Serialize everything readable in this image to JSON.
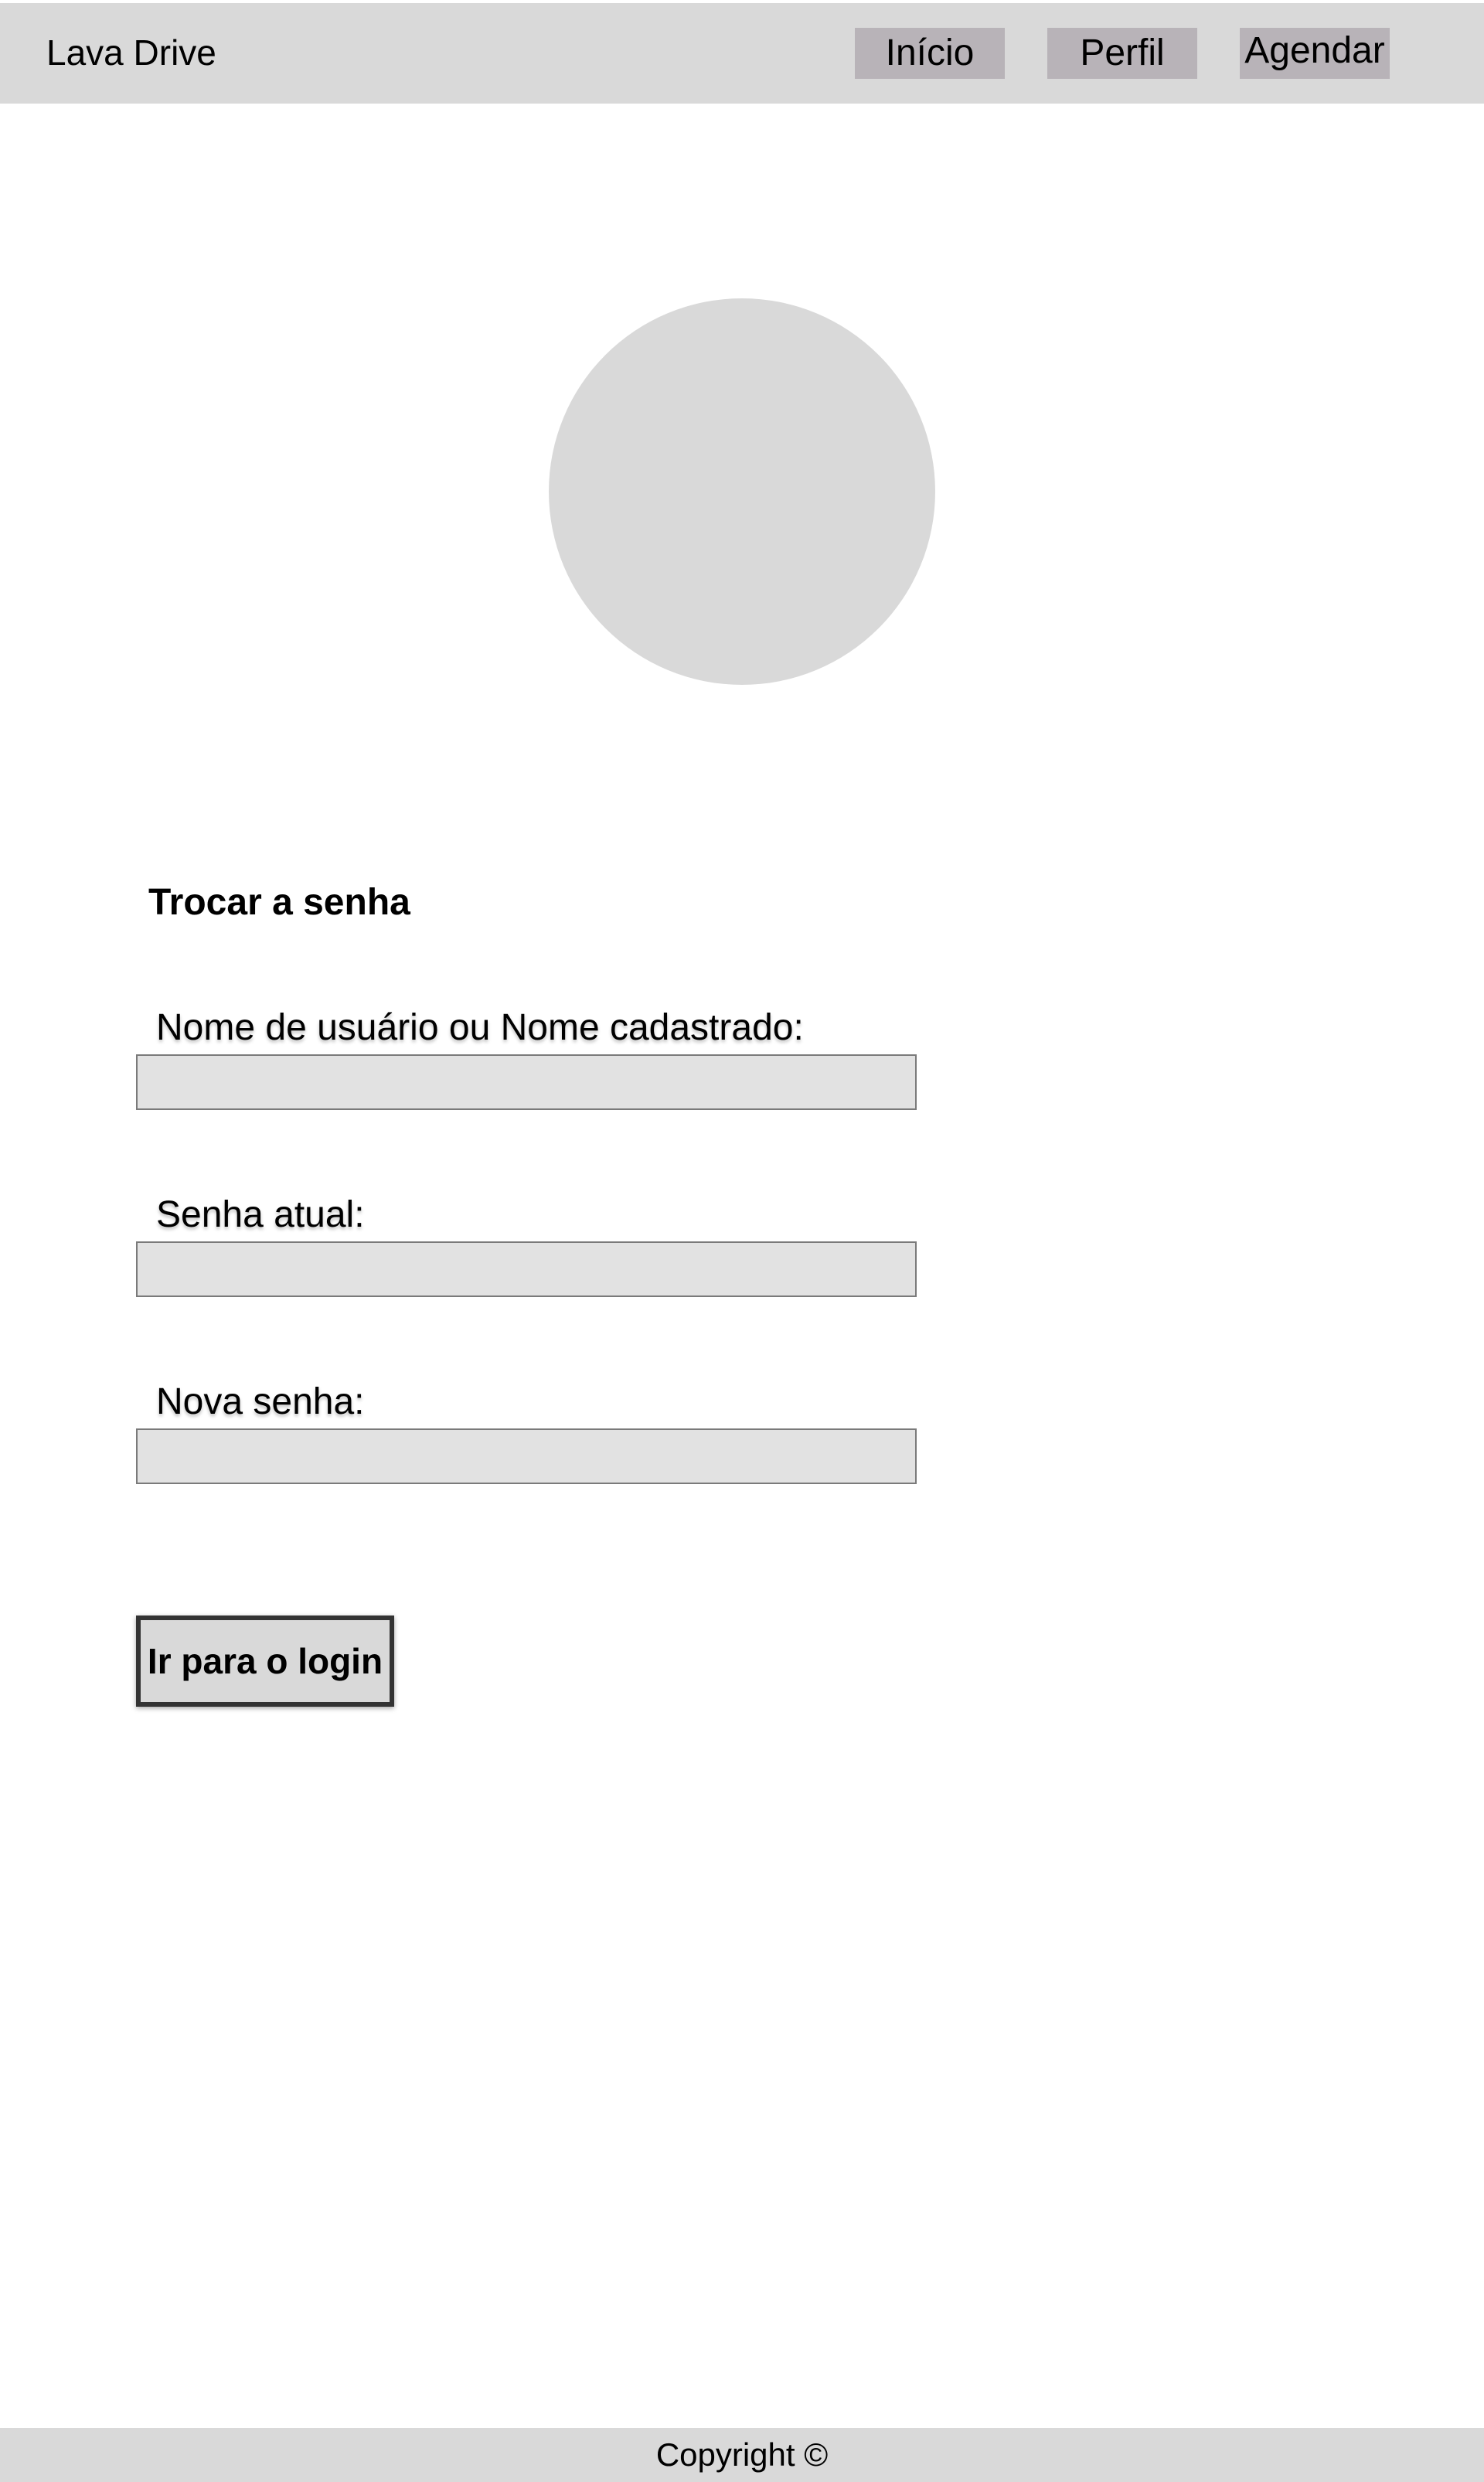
{
  "header": {
    "brand": "Lava Drive",
    "nav": {
      "inicio": "Início",
      "perfil": "Perfil",
      "agendar": "Agendar"
    }
  },
  "form": {
    "title": "Trocar a senha",
    "fields": {
      "username": {
        "label": "Nome de usuário ou Nome cadastrado:",
        "value": ""
      },
      "current_password": {
        "label": "Senha atual:",
        "value": ""
      },
      "new_password": {
        "label": "Nova senha:",
        "value": ""
      }
    },
    "login_button": "Ir para o login"
  },
  "footer": {
    "copyright": "Copyright ©"
  },
  "colors": {
    "header_bg": "#d9d9d9",
    "nav_button_bg": "#b8b3b8",
    "avatar_bg": "#d9d9d9",
    "input_bg": "#e2e2e2",
    "footer_bg": "#d9d9d9"
  }
}
